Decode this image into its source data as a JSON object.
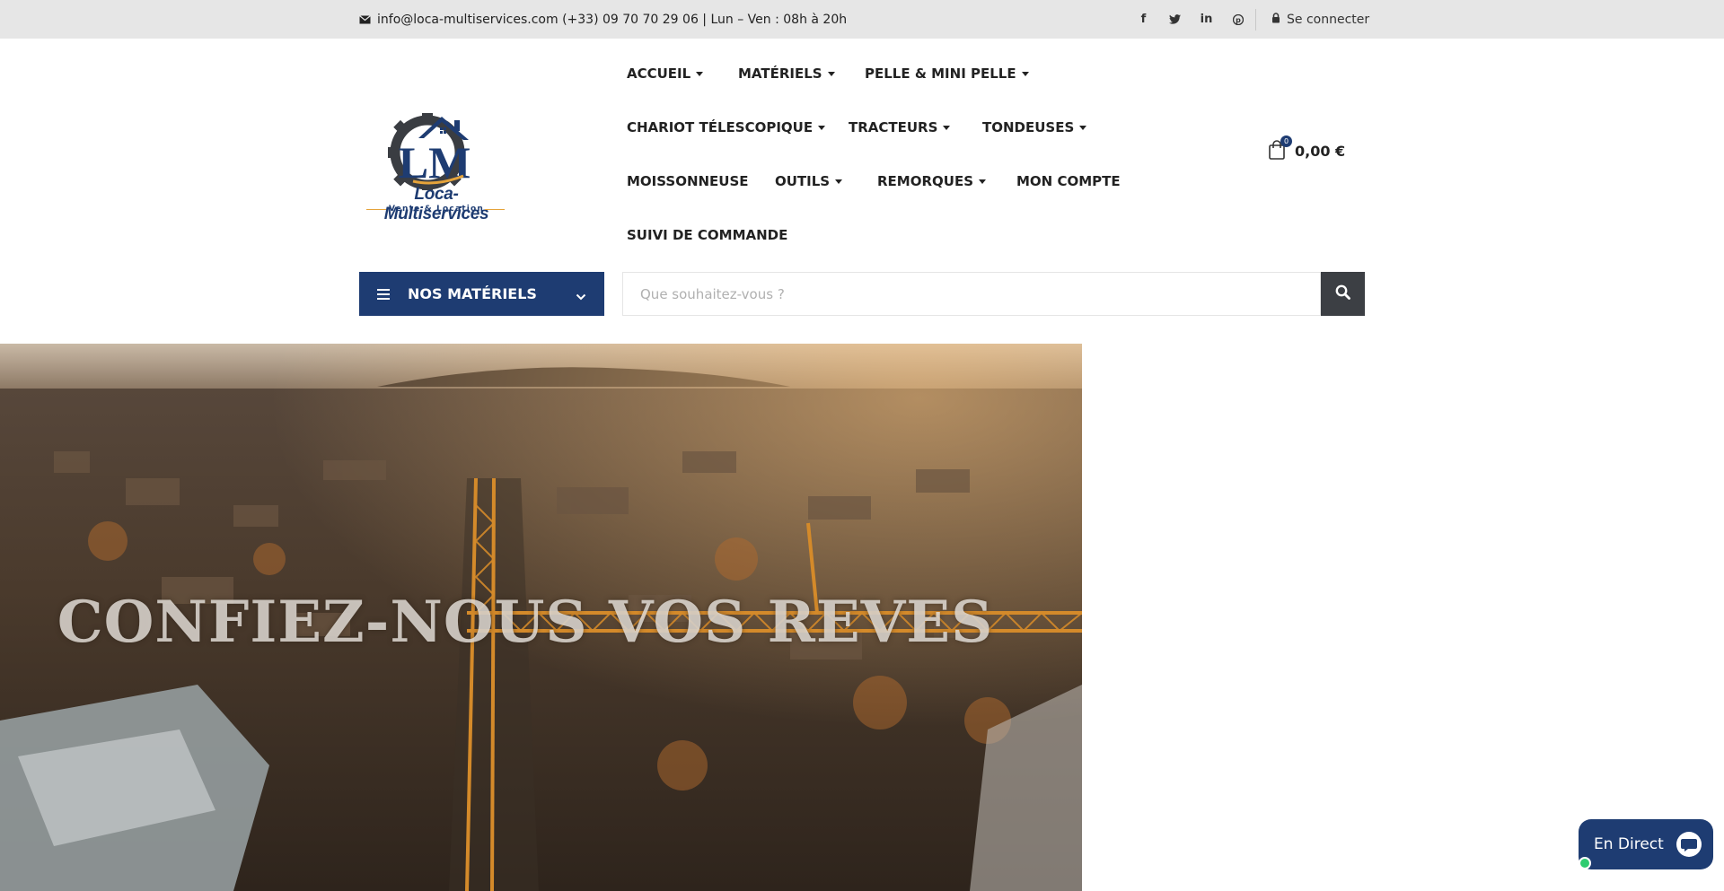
{
  "topbar": {
    "contact_text": "info@loca-multiservices.com (+33) 09 70 70 29 06 | Lun – Ven : 08h à 20h",
    "contact_icon": "envelope-icon",
    "socials": [
      {
        "name": "facebook",
        "glyph": "f"
      },
      {
        "name": "twitter",
        "glyph": "t"
      },
      {
        "name": "linkedin",
        "glyph": "in"
      },
      {
        "name": "pinterest",
        "glyph": "p"
      }
    ],
    "login_label": "Se connecter",
    "login_icon": "lock-icon"
  },
  "logo": {
    "brand": "Loca-Multiservices",
    "tagline": "Vente & Location",
    "monogram": "LM"
  },
  "nav": {
    "items": [
      {
        "label": "ACCUEIL",
        "dropdown": true
      },
      {
        "label": "MATÉRIELS",
        "dropdown": true
      },
      {
        "label": "PELLE & MINI PELLE",
        "dropdown": true
      },
      {
        "label": "CHARIOT TÉLESCOPIQUE",
        "dropdown": true
      },
      {
        "label": "TRACTEURS",
        "dropdown": true
      },
      {
        "label": "TONDEUSES",
        "dropdown": true
      },
      {
        "label": "MOISSONNEUSE",
        "dropdown": false
      },
      {
        "label": "OUTILS",
        "dropdown": true
      },
      {
        "label": "REMORQUES",
        "dropdown": true
      },
      {
        "label": "MON COMPTE",
        "dropdown": false
      },
      {
        "label": "SUIVI DE COMMANDE",
        "dropdown": false
      }
    ]
  },
  "cart": {
    "count": "0",
    "total": "0,00 €",
    "icon": "shopping-bag-icon"
  },
  "categories_button": {
    "label": "NOS MATÉRIELS"
  },
  "search": {
    "placeholder": "Que souhaitez-vous ?",
    "value": ""
  },
  "hero": {
    "headline": "CONFIEZ-NOUS VOS REVES"
  },
  "chat": {
    "label": "En Direct"
  },
  "colors": {
    "brand": "#1e3c72",
    "topbar_bg": "#e6e6e6",
    "search_button": "#3c3f44",
    "online": "#2ecc71",
    "logo_accent": "#e5a33a"
  }
}
